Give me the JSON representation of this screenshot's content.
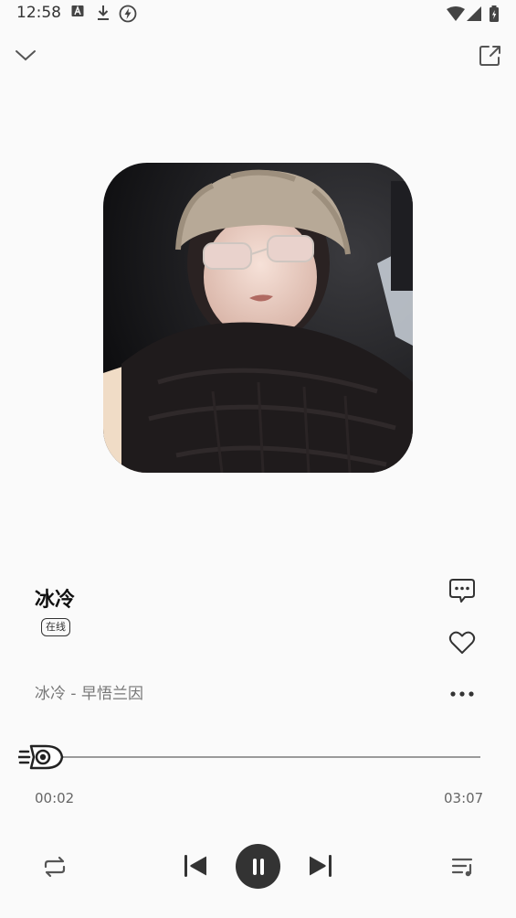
{
  "status_bar": {
    "time": "12:58"
  },
  "song": {
    "title": "冰冷",
    "badge": "在线",
    "subtitle": "冰冷 - 早悟兰因"
  },
  "progress": {
    "current": "00:02",
    "total": "03:07",
    "fraction": 0.011
  },
  "icons": {
    "collapse": "chevron-down-icon",
    "share": "external-link-icon",
    "comment": "comment-icon",
    "like": "heart-icon",
    "more": "more-icon",
    "repeat": "repeat-icon",
    "previous": "skip-previous-icon",
    "play_pause": "pause-icon",
    "next": "skip-next-icon",
    "playlist": "playlist-icon"
  },
  "colors": {
    "play_button": "#333333",
    "track": "#9a9a9a"
  }
}
